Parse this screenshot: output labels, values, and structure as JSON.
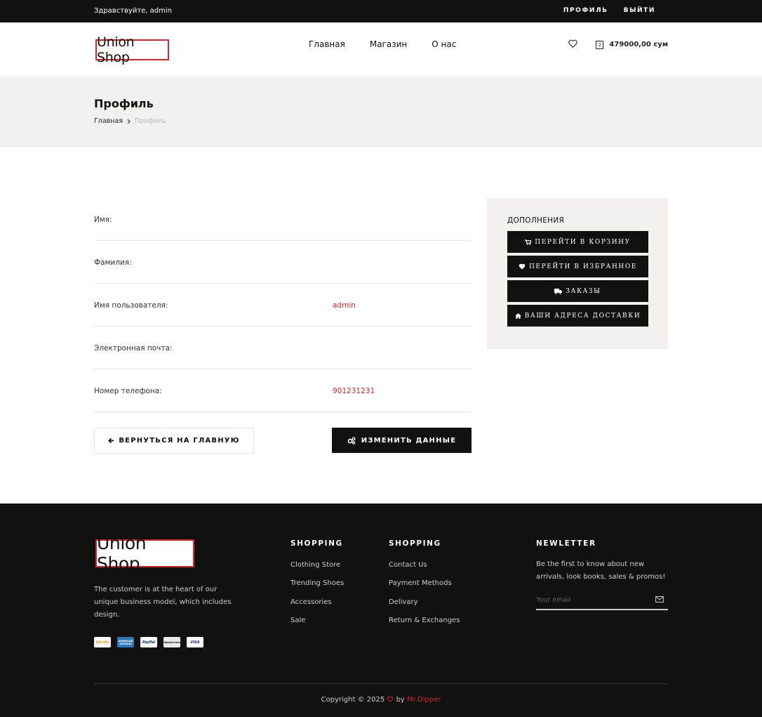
{
  "topbar": {
    "greeting": "Здравствуйте, admin",
    "profile_link": "ПРОФИЛЬ",
    "logout_link": "ВЫЙТИ"
  },
  "header": {
    "logo_text": "Union Shop",
    "nav": [
      "Главная",
      "Магазин",
      "О нас"
    ],
    "cart_count": "2",
    "cart_total": "479000,00 сум"
  },
  "page": {
    "title": "Профиль",
    "breadcrumb_home": "Главная",
    "breadcrumb_current": "Профиль"
  },
  "profile": {
    "rows": [
      {
        "label": "Имя:",
        "value": ""
      },
      {
        "label": "Фамилия:",
        "value": ""
      },
      {
        "label": "Имя пользователя:",
        "value": "admin"
      },
      {
        "label": "Электронная почта:",
        "value": ""
      },
      {
        "label": "Номер телефона:",
        "value": "901231231"
      }
    ],
    "back_button": "ВЕРНУТЬСЯ НА ГЛАВНУЮ",
    "edit_button": "ИЗМЕНИТЬ ДАННЫЕ"
  },
  "side": {
    "title": "ДОПОЛНЕНИЯ",
    "buttons": [
      "ПЕРЕЙТИ В КОРЗИНУ",
      "ПЕРЕЙТИ В ИЗБРАННОЕ",
      "ЗАКАЗЫ",
      "ВАШИ АДРЕСА ДОСТАВКИ"
    ]
  },
  "footer": {
    "logo_text": "Union Shop",
    "description": "The customer is at the heart of our unique business model, which includes design.",
    "payment_cards": [
      "bitcoin",
      "AMERICAN EXPRESS",
      "PayPal",
      "MasterCard",
      "VISA"
    ],
    "col1": {
      "title": "SHOPPING",
      "links": [
        "Clothing Store",
        "Trending Shoes",
        "Accessories",
        "Sale"
      ]
    },
    "col2": {
      "title": "SHOPPING",
      "links": [
        "Contact Us",
        "Payment Methods",
        "Delivary",
        "Return & Exchanges"
      ]
    },
    "newsletter": {
      "title": "NEWLETTER",
      "text": "Be the first to know about new arrivals, look books, sales & promos!",
      "placeholder": "Your email"
    },
    "copyright_prefix": "Copyright © 2025",
    "copyright_by": "by",
    "author": "Mr.Dipper"
  },
  "colors": {
    "accent": "#d9242b",
    "dark": "#111111",
    "band": "#f2f1ed"
  }
}
